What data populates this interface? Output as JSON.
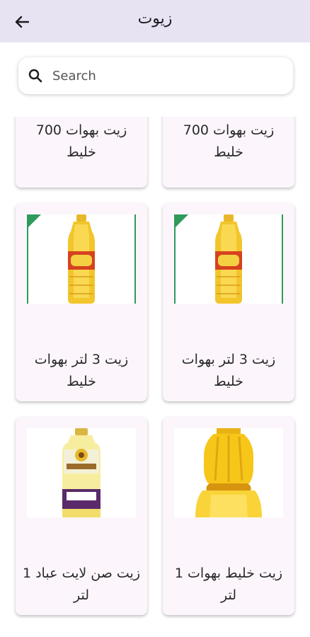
{
  "header": {
    "title": "زيوت"
  },
  "search": {
    "placeholder": "Search"
  },
  "products": [
    {
      "name": "زيت بهوات 700 خليط",
      "image": ""
    },
    {
      "name": "زيت بهوات 700 خليط",
      "image": ""
    },
    {
      "name": "زيت 3 لتر بهوات خليط",
      "image": "yellow-oil-bottle-green-frame"
    },
    {
      "name": "زيت 3 لتر بهوات خليط",
      "image": "yellow-oil-bottle-green-frame"
    },
    {
      "name": "زيت خليط بهوات 1 لتر",
      "image": "oil-bottle-closeup"
    },
    {
      "name": "زيت صن لايت عباد 1 لتر",
      "image": "sunflower-oil-bottle"
    }
  ]
}
